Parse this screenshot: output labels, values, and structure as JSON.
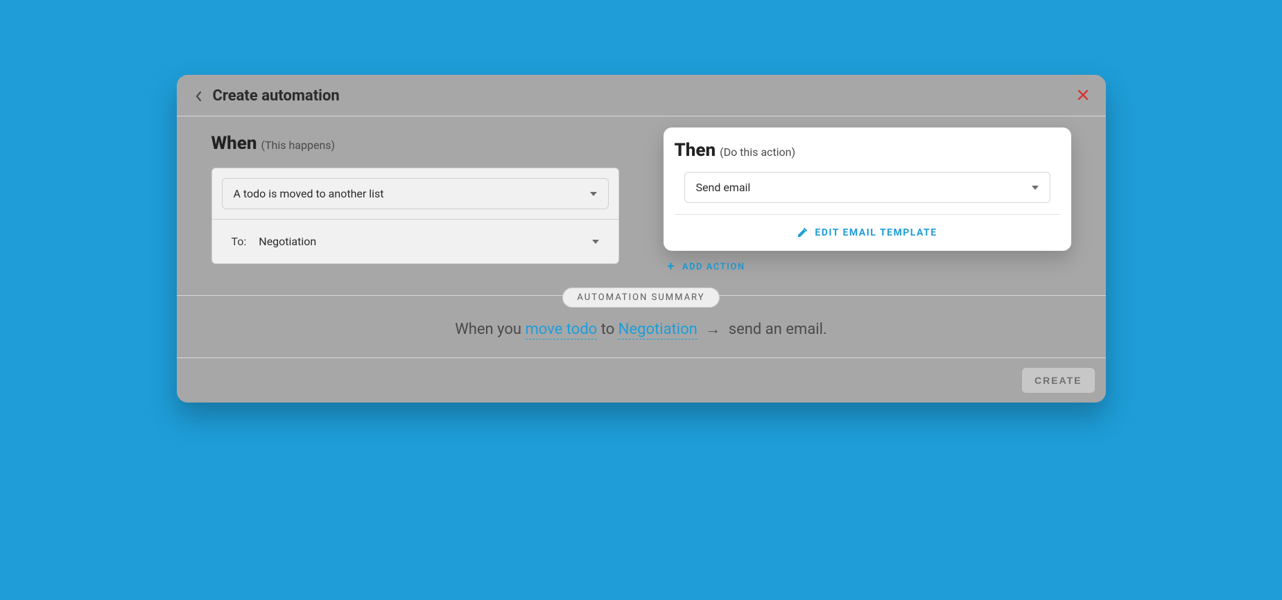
{
  "header": {
    "title": "Create automation"
  },
  "when": {
    "title": "When",
    "subtitle": "(This happens)",
    "trigger": "A todo is moved to another list",
    "to_label": "To:",
    "to_value": "Negotiation"
  },
  "then": {
    "title": "Then",
    "subtitle": "(Do this action)",
    "action": "Send email",
    "edit_label": "EDIT EMAIL TEMPLATE",
    "add_label": "ADD ACTION"
  },
  "summary": {
    "pill": "AUTOMATION SUMMARY",
    "prefix": "When you ",
    "link1": "move todo",
    "mid": " to ",
    "link2": "Negotiation",
    "arrow": "→",
    "suffix": " send an email."
  },
  "footer": {
    "create": "CREATE"
  }
}
